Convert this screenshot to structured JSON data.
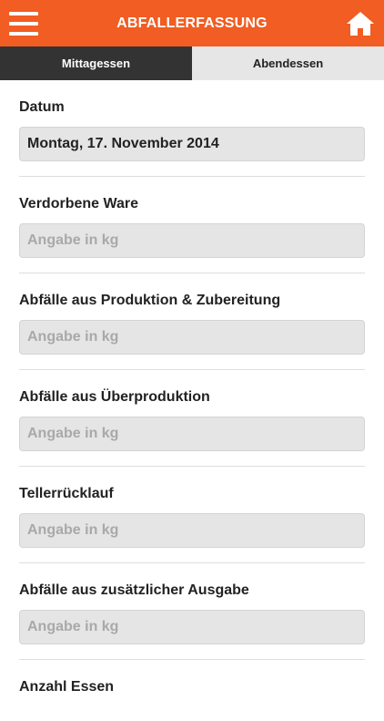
{
  "header": {
    "title": "ABFALLERFASSUNG"
  },
  "tabs": [
    {
      "label": "Mittagessen",
      "active": true
    },
    {
      "label": "Abendessen",
      "active": false
    }
  ],
  "fields": [
    {
      "label": "Datum",
      "value": "Montag, 17. November 2014",
      "placeholder": ""
    },
    {
      "label": "Verdorbene Ware",
      "value": "",
      "placeholder": "Angabe in kg"
    },
    {
      "label": "Abfälle aus Produktion & Zubereitung",
      "value": "",
      "placeholder": "Angabe in kg"
    },
    {
      "label": "Abfälle aus Überproduktion",
      "value": "",
      "placeholder": "Angabe in kg"
    },
    {
      "label": "Tellerrücklauf",
      "value": "",
      "placeholder": "Angabe in kg"
    },
    {
      "label": "Abfälle aus zusätzlicher Ausgabe",
      "value": "",
      "placeholder": "Angabe in kg"
    },
    {
      "label": "Anzahl Essen",
      "value": "",
      "placeholder": ""
    }
  ],
  "colors": {
    "accent": "#f15d22",
    "tab_active": "#333333",
    "tab_inactive": "#e6e6e6"
  },
  "icons": {
    "menu": "hamburger-icon",
    "home": "home-icon"
  }
}
